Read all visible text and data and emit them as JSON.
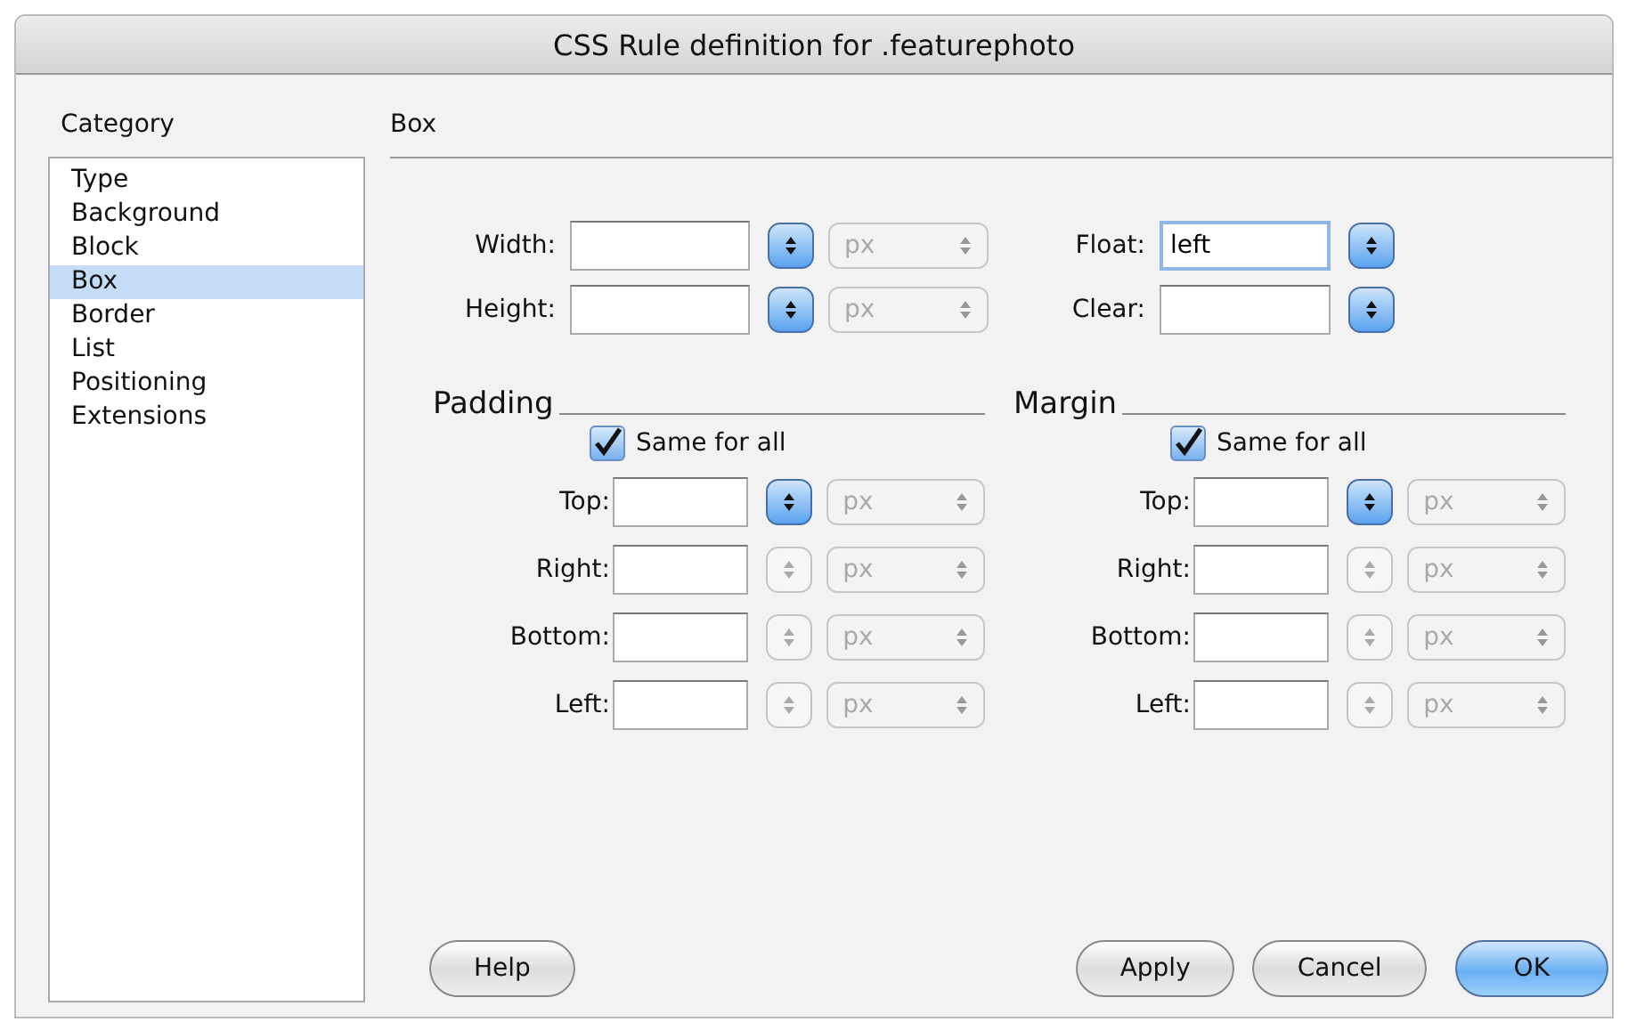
{
  "window": {
    "title": "CSS Rule definition for .featurephoto"
  },
  "category": {
    "heading": "Category",
    "items": [
      {
        "label": "Type",
        "selected": false
      },
      {
        "label": "Background",
        "selected": false
      },
      {
        "label": "Block",
        "selected": false
      },
      {
        "label": "Box",
        "selected": true
      },
      {
        "label": "Border",
        "selected": false
      },
      {
        "label": "List",
        "selected": false
      },
      {
        "label": "Positioning",
        "selected": false
      },
      {
        "label": "Extensions",
        "selected": false
      }
    ]
  },
  "panel": {
    "title": "Box"
  },
  "size_fields": [
    {
      "label": "Width:",
      "stepper_disabled": false,
      "unit": {
        "text": "px",
        "disabled": true
      }
    },
    {
      "label": "Height:",
      "stepper_disabled": false,
      "unit": {
        "text": "px",
        "disabled": true
      }
    }
  ],
  "float_fields": [
    {
      "label": "Float:",
      "value": "left",
      "focused": true,
      "stepper_disabled": false
    },
    {
      "label": "Clear:",
      "focused": false,
      "stepper_disabled": false
    }
  ],
  "groups": [
    {
      "title": "Padding",
      "same_for_all": {
        "label": "Same for all",
        "checked": true
      },
      "sides": [
        {
          "label": "Top:",
          "stepper_disabled": false,
          "unit": {
            "text": "px",
            "disabled": true
          }
        },
        {
          "label": "Right:",
          "stepper_disabled": true,
          "unit": {
            "text": "px",
            "disabled": true
          }
        },
        {
          "label": "Bottom:",
          "stepper_disabled": true,
          "unit": {
            "text": "px",
            "disabled": true
          }
        },
        {
          "label": "Left:",
          "stepper_disabled": true,
          "unit": {
            "text": "px",
            "disabled": true
          }
        }
      ]
    },
    {
      "title": "Margin",
      "same_for_all": {
        "label": "Same for all",
        "checked": true
      },
      "sides": [
        {
          "label": "Top:",
          "stepper_disabled": false,
          "unit": {
            "text": "px",
            "disabled": true
          }
        },
        {
          "label": "Right:",
          "stepper_disabled": true,
          "unit": {
            "text": "px",
            "disabled": true
          }
        },
        {
          "label": "Bottom:",
          "stepper_disabled": true,
          "unit": {
            "text": "px",
            "disabled": true
          }
        },
        {
          "label": "Left:",
          "stepper_disabled": true,
          "unit": {
            "text": "px",
            "disabled": true
          }
        }
      ]
    }
  ],
  "buttons": [
    {
      "label": "Help",
      "kind": "plain"
    },
    {
      "label": "Apply",
      "kind": "plain"
    },
    {
      "label": "Cancel",
      "kind": "plain"
    },
    {
      "label": "OK",
      "kind": "default"
    }
  ]
}
